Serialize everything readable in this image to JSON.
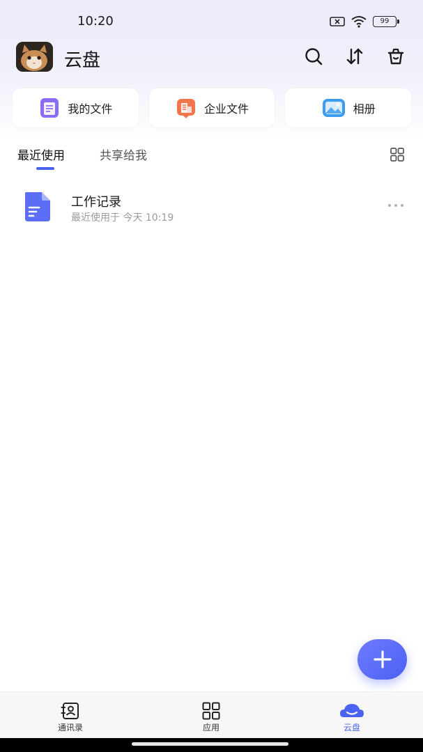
{
  "status_bar": {
    "time": "10:20",
    "battery": "99",
    "icons": [
      "sim-x-icon",
      "wifi-icon",
      "battery-icon"
    ]
  },
  "header": {
    "title": "云盘",
    "actions": [
      "search-icon",
      "transfer-icon",
      "trash-icon"
    ]
  },
  "quick_access": [
    {
      "label": "我的文件",
      "icon": "my-files-icon",
      "color": "#8b6cf6"
    },
    {
      "label": "企业文件",
      "icon": "enterprise-files-icon",
      "color": "#f2754d"
    },
    {
      "label": "相册",
      "icon": "album-icon",
      "color": "#3b9cf0"
    }
  ],
  "tabs": {
    "active": "最近使用",
    "inactive": "共享给我"
  },
  "files": [
    {
      "name": "工作记录",
      "meta": "最近使用于 今天 10:19",
      "icon": "document-icon",
      "color": "#5b6ef5"
    }
  ],
  "bottom_nav": [
    {
      "label": "通讯录",
      "icon": "contacts-icon",
      "active": false
    },
    {
      "label": "应用",
      "icon": "apps-grid-icon",
      "active": false
    },
    {
      "label": "云盘",
      "icon": "cloud-icon",
      "active": true
    }
  ],
  "colors": {
    "accent": "#4b63f0",
    "background": "#ffffff",
    "muted_text": "#9a9a9a"
  }
}
